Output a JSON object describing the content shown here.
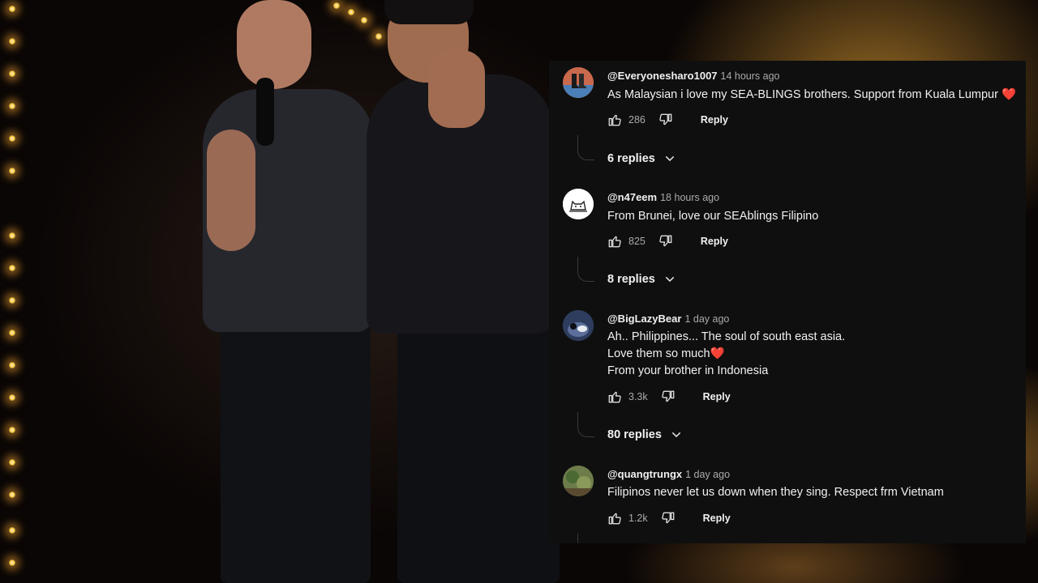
{
  "comments": [
    {
      "author": "@Everyonesharo1007",
      "time": "14 hours ago",
      "text": "As Malaysian i love my SEA-BLINGS brothers. Support from Kuala Lumpur",
      "emoji": "❤️",
      "likes": "286",
      "reply_label": "Reply",
      "replies_label": "6 replies",
      "avatar": "shoes-avatar"
    },
    {
      "author": "@n47eem",
      "time": "18 hours ago",
      "text": "From Brunei, love our SEAblings Filipino",
      "likes": "825",
      "reply_label": "Reply",
      "replies_label": "8 replies",
      "avatar": "cat-avatar"
    },
    {
      "author": "@BigLazyBear",
      "time": "1 day ago",
      "text_lines": [
        "Ah.. Philippines... The soul of south east asia.",
        "Love them so much",
        "From your brother in Indonesia"
      ],
      "emoji": "❤️",
      "likes": "3.3k",
      "reply_label": "Reply",
      "replies_label": "80 replies",
      "avatar": "bear-avatar"
    },
    {
      "author": "@quangtrungx",
      "time": "1 day ago",
      "text": "Filipinos never let us down when they sing. Respect frm Vietnam",
      "likes": "1.2k",
      "reply_label": "Reply",
      "avatar": "nature-avatar"
    }
  ],
  "colors": {
    "panel_bg": "#0f0f0f",
    "text_primary": "#f1f1f1",
    "text_secondary": "#aaaaaa",
    "heart": "#ff3b3b"
  },
  "icons": [
    "thumbs-up-icon",
    "thumbs-down-icon",
    "chevron-down-icon"
  ]
}
